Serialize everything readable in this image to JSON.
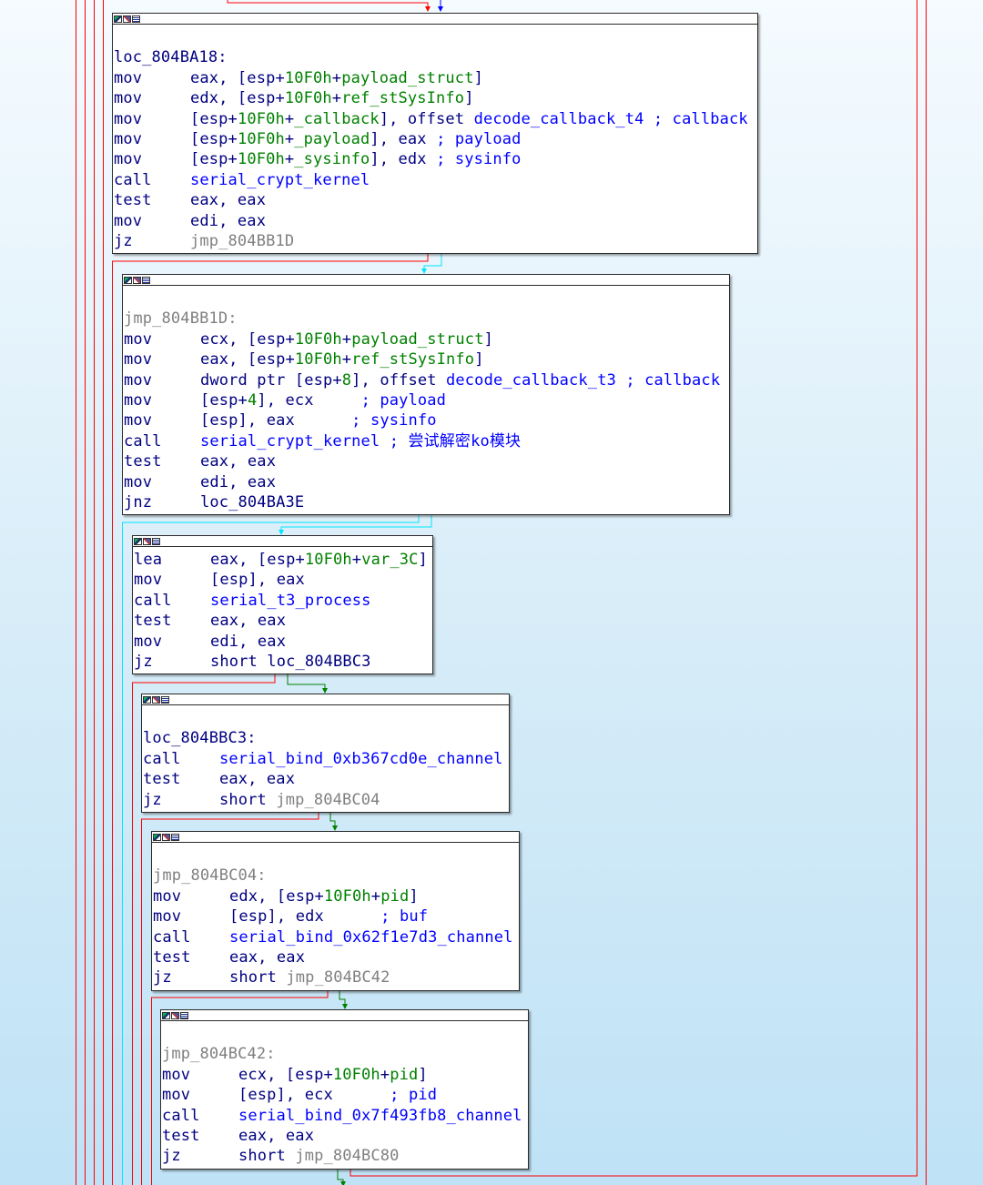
{
  "blocks": [
    {
      "id": "blk-loc-804ba18",
      "label": "loc_804BA18:",
      "label_style": "dark",
      "lines": [
        {
          "mnemonic": "mov",
          "parts": [
            [
              "eax, [esp+",
              "dark"
            ],
            [
              "10F0h",
              "green"
            ],
            [
              "+",
              "dark"
            ],
            [
              "payload_struct",
              "green"
            ],
            [
              "]",
              "dark"
            ]
          ]
        },
        {
          "mnemonic": "mov",
          "parts": [
            [
              "edx, [esp+",
              "dark"
            ],
            [
              "10F0h",
              "green"
            ],
            [
              "+",
              "dark"
            ],
            [
              "ref_stSysInfo",
              "green"
            ],
            [
              "]",
              "dark"
            ]
          ]
        },
        {
          "mnemonic": "mov",
          "parts": [
            [
              "[esp+",
              "dark"
            ],
            [
              "10F0h",
              "green"
            ],
            [
              "+",
              "dark"
            ],
            [
              "_callback",
              "green"
            ],
            [
              "], offset ",
              "dark"
            ],
            [
              "decode_callback_t4",
              "blue"
            ],
            [
              " ; callback",
              "blue"
            ]
          ]
        },
        {
          "mnemonic": "mov",
          "parts": [
            [
              "[esp+",
              "dark"
            ],
            [
              "10F0h",
              "green"
            ],
            [
              "+",
              "dark"
            ],
            [
              "_payload",
              "green"
            ],
            [
              "], eax ",
              "dark"
            ],
            [
              "; payload",
              "blue"
            ]
          ]
        },
        {
          "mnemonic": "mov",
          "parts": [
            [
              "[esp+",
              "dark"
            ],
            [
              "10F0h",
              "green"
            ],
            [
              "+",
              "dark"
            ],
            [
              "_sysinfo",
              "green"
            ],
            [
              "], edx ",
              "dark"
            ],
            [
              "; sysinfo",
              "blue"
            ]
          ]
        },
        {
          "mnemonic": "call",
          "parts": [
            [
              "serial_crypt_kernel",
              "blue"
            ]
          ]
        },
        {
          "mnemonic": "test",
          "parts": [
            [
              "eax, eax",
              "dark"
            ]
          ]
        },
        {
          "mnemonic": "mov",
          "parts": [
            [
              "edi, eax",
              "dark"
            ]
          ]
        },
        {
          "mnemonic": "jz",
          "parts": [
            [
              "jmp_804BB1D",
              "gray"
            ]
          ]
        }
      ]
    },
    {
      "id": "blk-jmp-804bb1d",
      "label": "jmp_804BB1D:",
      "label_style": "gray",
      "lines": [
        {
          "mnemonic": "mov",
          "parts": [
            [
              "ecx, [esp+",
              "dark"
            ],
            [
              "10F0h",
              "green"
            ],
            [
              "+",
              "dark"
            ],
            [
              "payload_struct",
              "green"
            ],
            [
              "]",
              "dark"
            ]
          ]
        },
        {
          "mnemonic": "mov",
          "parts": [
            [
              "eax, [esp+",
              "dark"
            ],
            [
              "10F0h",
              "green"
            ],
            [
              "+",
              "dark"
            ],
            [
              "ref_stSysInfo",
              "green"
            ],
            [
              "]",
              "dark"
            ]
          ]
        },
        {
          "mnemonic": "mov",
          "parts": [
            [
              "dword ptr [esp+",
              "dark"
            ],
            [
              "8",
              "green"
            ],
            [
              "], offset ",
              "dark"
            ],
            [
              "decode_callback_t3",
              "blue"
            ],
            [
              " ; callback",
              "blue"
            ]
          ]
        },
        {
          "mnemonic": "mov",
          "parts": [
            [
              "[esp+",
              "dark"
            ],
            [
              "4",
              "green"
            ],
            [
              "], ecx     ",
              "dark"
            ],
            [
              "; payload",
              "blue"
            ]
          ]
        },
        {
          "mnemonic": "mov",
          "parts": [
            [
              "[esp], eax      ",
              "dark"
            ],
            [
              "; sysinfo",
              "blue"
            ]
          ]
        },
        {
          "mnemonic": "call",
          "parts": [
            [
              "serial_crypt_kernel",
              "blue"
            ],
            [
              " ; 尝试解密ko模块",
              "blue"
            ]
          ]
        },
        {
          "mnemonic": "test",
          "parts": [
            [
              "eax, eax",
              "dark"
            ]
          ]
        },
        {
          "mnemonic": "mov",
          "parts": [
            [
              "edi, eax",
              "dark"
            ]
          ]
        },
        {
          "mnemonic": "jnz",
          "parts": [
            [
              "loc_804BA3E",
              "dark"
            ]
          ]
        }
      ]
    },
    {
      "id": "blk-lea-var3c",
      "label": "",
      "label_style": "none",
      "lines": [
        {
          "mnemonic": "lea",
          "parts": [
            [
              "eax, [esp+",
              "dark"
            ],
            [
              "10F0h",
              "green"
            ],
            [
              "+",
              "dark"
            ],
            [
              "var_3C",
              "green"
            ],
            [
              "]",
              "dark"
            ]
          ]
        },
        {
          "mnemonic": "mov",
          "parts": [
            [
              "[esp], eax",
              "dark"
            ]
          ]
        },
        {
          "mnemonic": "call",
          "parts": [
            [
              "serial_t3_process",
              "blue"
            ]
          ]
        },
        {
          "mnemonic": "test",
          "parts": [
            [
              "eax, eax",
              "dark"
            ]
          ]
        },
        {
          "mnemonic": "mov",
          "parts": [
            [
              "edi, eax",
              "dark"
            ]
          ]
        },
        {
          "mnemonic": "jz",
          "parts": [
            [
              "short loc_804BBC3",
              "dark"
            ]
          ]
        }
      ]
    },
    {
      "id": "blk-loc-804bbc3",
      "label": "loc_804BBC3:",
      "label_style": "dark",
      "lines": [
        {
          "mnemonic": "call",
          "parts": [
            [
              "serial_bind_0xb367cd0e_channel",
              "blue"
            ]
          ]
        },
        {
          "mnemonic": "test",
          "parts": [
            [
              "eax, eax",
              "dark"
            ]
          ]
        },
        {
          "mnemonic": "jz",
          "parts": [
            [
              "short ",
              "dark"
            ],
            [
              "jmp_804BC04",
              "gray"
            ]
          ]
        }
      ]
    },
    {
      "id": "blk-jmp-804bc04",
      "label": "jmp_804BC04:",
      "label_style": "gray",
      "lines": [
        {
          "mnemonic": "mov",
          "parts": [
            [
              "edx, [esp+",
              "dark"
            ],
            [
              "10F0h",
              "green"
            ],
            [
              "+",
              "dark"
            ],
            [
              "pid",
              "green"
            ],
            [
              "]",
              "dark"
            ]
          ]
        },
        {
          "mnemonic": "mov",
          "parts": [
            [
              "[esp], edx      ",
              "dark"
            ],
            [
              "; buf",
              "blue"
            ]
          ]
        },
        {
          "mnemonic": "call",
          "parts": [
            [
              "serial_bind_0x62f1e7d3_channel",
              "blue"
            ]
          ]
        },
        {
          "mnemonic": "test",
          "parts": [
            [
              "eax, eax",
              "dark"
            ]
          ]
        },
        {
          "mnemonic": "jz",
          "parts": [
            [
              "short ",
              "dark"
            ],
            [
              "jmp_804BC42",
              "gray"
            ]
          ]
        }
      ]
    },
    {
      "id": "blk-jmp-804bc42",
      "label": "jmp_804BC42:",
      "label_style": "gray",
      "lines": [
        {
          "mnemonic": "mov",
          "parts": [
            [
              "ecx, [esp+",
              "dark"
            ],
            [
              "10F0h",
              "green"
            ],
            [
              "+",
              "dark"
            ],
            [
              "pid",
              "green"
            ],
            [
              "]",
              "dark"
            ]
          ]
        },
        {
          "mnemonic": "mov",
          "parts": [
            [
              "[esp], ecx      ",
              "dark"
            ],
            [
              "; pid",
              "blue"
            ]
          ]
        },
        {
          "mnemonic": "call",
          "parts": [
            [
              "serial_bind_0x7f493fb8_channel",
              "blue"
            ]
          ]
        },
        {
          "mnemonic": "test",
          "parts": [
            [
              "eax, eax",
              "dark"
            ]
          ]
        },
        {
          "mnemonic": "jz",
          "parts": [
            [
              "short ",
              "dark"
            ],
            [
              "jmp_804BC80",
              "gray"
            ]
          ]
        }
      ]
    }
  ],
  "colors": {
    "background_top": "#f5fbff",
    "background_bottom": "#bfe2f6",
    "edge_true": "#008000",
    "edge_false": "#ff0000",
    "edge_unconditional": "#0000ff",
    "edge_fallthrough": "#00e5ff",
    "text_dark": "#000080",
    "text_blue": "#0000ff",
    "text_green": "#008000",
    "text_gray": "#808080"
  }
}
